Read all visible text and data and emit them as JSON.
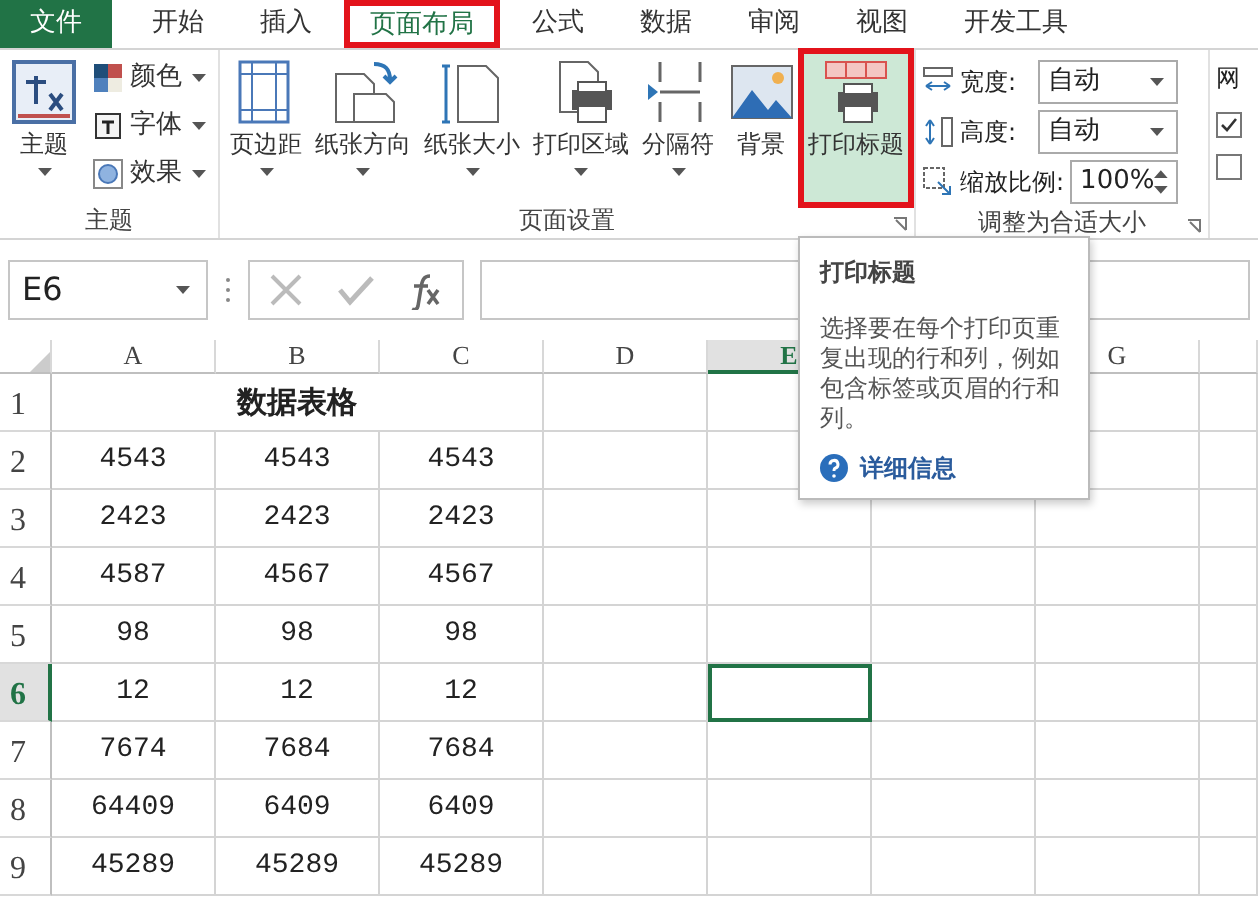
{
  "menu_tabs": [
    {
      "label": "文件",
      "kind": "file",
      "selected": false,
      "highlighted": false
    },
    {
      "label": "开始",
      "kind": "tab",
      "selected": false,
      "highlighted": false
    },
    {
      "label": "插入",
      "kind": "tab",
      "selected": false,
      "highlighted": false
    },
    {
      "label": "页面布局",
      "kind": "tab",
      "selected": true,
      "highlighted": true
    },
    {
      "label": "公式",
      "kind": "tab",
      "selected": false,
      "highlighted": false
    },
    {
      "label": "数据",
      "kind": "tab",
      "selected": false,
      "highlighted": false
    },
    {
      "label": "审阅",
      "kind": "tab",
      "selected": false,
      "highlighted": false
    },
    {
      "label": "视图",
      "kind": "tab",
      "selected": false,
      "highlighted": false
    },
    {
      "label": "开发工具",
      "kind": "tab",
      "selected": false,
      "highlighted": false
    }
  ],
  "ribbon": {
    "themes": {
      "title": "主题",
      "main": {
        "label": "主题",
        "dropdown": true
      },
      "items": [
        {
          "label": "颜色",
          "dropdown": true
        },
        {
          "label": "字体",
          "dropdown": true
        },
        {
          "label": "效果",
          "dropdown": true
        }
      ]
    },
    "page_setup": {
      "title": "页面设置",
      "launcher": true,
      "items": [
        {
          "label": "页边距",
          "dropdown": true,
          "hovered": false,
          "highlighted": false
        },
        {
          "label": "纸张方向",
          "dropdown": true,
          "hovered": false,
          "highlighted": false
        },
        {
          "label": "纸张大小",
          "dropdown": true,
          "hovered": false,
          "highlighted": false
        },
        {
          "label": "打印区域",
          "dropdown": true,
          "hovered": false,
          "highlighted": false
        },
        {
          "label": "分隔符",
          "dropdown": true,
          "hovered": false,
          "highlighted": false
        },
        {
          "label": "背景",
          "dropdown": false,
          "hovered": false,
          "highlighted": false
        },
        {
          "label": "打印标题",
          "dropdown": false,
          "hovered": true,
          "highlighted": true
        }
      ]
    },
    "scale": {
      "title": "调整为合适大小",
      "launcher": true,
      "rows": [
        {
          "kind": "select",
          "label": "宽度:",
          "value": "自动"
        },
        {
          "kind": "select",
          "label": "高度:",
          "value": "自动"
        },
        {
          "kind": "spin",
          "label": "缩放比例:",
          "value": "100%"
        }
      ]
    },
    "gridlines": {
      "title": "网",
      "checkboxes": [
        {
          "checked": true
        },
        {
          "checked": false
        }
      ]
    }
  },
  "formula_bar": {
    "name_box": "E6"
  },
  "sheet": {
    "columns": [
      {
        "label": "A",
        "selected": false
      },
      {
        "label": "B",
        "selected": false
      },
      {
        "label": "C",
        "selected": false
      },
      {
        "label": "D",
        "selected": false
      },
      {
        "label": "E",
        "selected": true
      },
      {
        "label": "G",
        "selected": false
      }
    ],
    "title_row_number": "1",
    "title": "数据表格",
    "rows": [
      {
        "number": "2",
        "selected": false,
        "cells": [
          "4543",
          "4543",
          "4543"
        ]
      },
      {
        "number": "3",
        "selected": false,
        "cells": [
          "2423",
          "2423",
          "2423"
        ]
      },
      {
        "number": "4",
        "selected": false,
        "cells": [
          "4587",
          "4567",
          "4567"
        ]
      },
      {
        "number": "5",
        "selected": false,
        "cells": [
          "98",
          "98",
          "98"
        ]
      },
      {
        "number": "6",
        "selected": true,
        "cells": [
          "12",
          "12",
          "12"
        ]
      },
      {
        "number": "7",
        "selected": false,
        "cells": [
          "7674",
          "7684",
          "7684"
        ]
      },
      {
        "number": "8",
        "selected": false,
        "cells": [
          "64409",
          "6409",
          "6409"
        ]
      },
      {
        "number": "9",
        "selected": false,
        "cells": [
          "45289",
          "45289",
          "45289"
        ]
      }
    ]
  },
  "tooltip": {
    "title": "打印标题",
    "description": "选择要在每个打印页重复出现的行和列，例如包含标签或页眉的行和列。",
    "help_link": "详细信息"
  }
}
